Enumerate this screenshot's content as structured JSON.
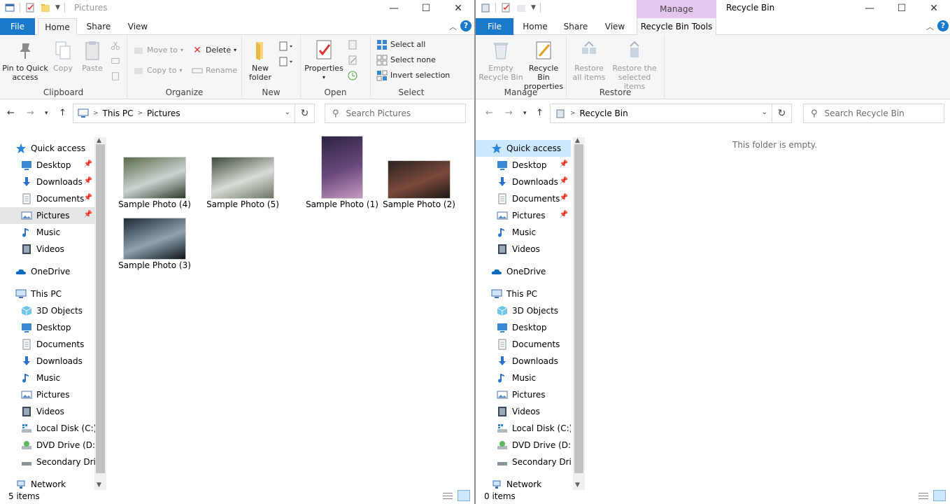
{
  "left": {
    "title": "Pictures",
    "tabs": {
      "file": "File",
      "home": "Home",
      "share": "Share",
      "view": "View"
    },
    "ribbon": {
      "clipboard": {
        "label": "Clipboard",
        "pin": "Pin to Quick\naccess",
        "copy": "Copy",
        "paste": "Paste"
      },
      "organize": {
        "label": "Organize",
        "move_to": "Move to",
        "copy_to": "Copy to",
        "delete": "Delete",
        "rename": "Rename"
      },
      "new": {
        "label": "New",
        "new_folder": "New\nfolder"
      },
      "open": {
        "label": "Open",
        "properties": "Properties"
      },
      "select": {
        "label": "Select",
        "select_all": "Select all",
        "select_none": "Select none",
        "invert": "Invert selection"
      }
    },
    "address": {
      "crumbs": [
        "This PC",
        "Pictures"
      ],
      "search_placeholder": "Search Pictures"
    },
    "nav": [
      {
        "label": "Quick access",
        "icon": "star-icon",
        "level": 0
      },
      {
        "label": "Desktop",
        "icon": "desktop-icon",
        "level": 1,
        "pinned": true
      },
      {
        "label": "Downloads",
        "icon": "download-icon",
        "level": 1,
        "pinned": true
      },
      {
        "label": "Documents",
        "icon": "document-icon",
        "level": 1,
        "pinned": true
      },
      {
        "label": "Pictures",
        "icon": "pictures-icon",
        "level": 1,
        "pinned": true,
        "highlight": true
      },
      {
        "label": "Music",
        "icon": "music-icon",
        "level": 1
      },
      {
        "label": "Videos",
        "icon": "video-icon",
        "level": 1
      },
      {
        "label": "OneDrive",
        "icon": "cloud-icon",
        "level": 0
      },
      {
        "label": "This PC",
        "icon": "computer-icon",
        "level": 0
      },
      {
        "label": "3D Objects",
        "icon": "cube-icon",
        "level": 1
      },
      {
        "label": "Desktop",
        "icon": "desktop-icon",
        "level": 1
      },
      {
        "label": "Documents",
        "icon": "document-icon",
        "level": 1
      },
      {
        "label": "Downloads",
        "icon": "download-icon",
        "level": 1
      },
      {
        "label": "Music",
        "icon": "music-icon",
        "level": 1
      },
      {
        "label": "Pictures",
        "icon": "pictures-icon",
        "level": 1
      },
      {
        "label": "Videos",
        "icon": "video-icon",
        "level": 1
      },
      {
        "label": "Local Disk (C:)",
        "icon": "disk-icon",
        "level": 1
      },
      {
        "label": "DVD Drive (D:) ES",
        "icon": "dvd-icon",
        "level": 1
      },
      {
        "label": "Secondary Drive",
        "icon": "drive-icon",
        "level": 1
      },
      {
        "label": "Network",
        "icon": "network-icon",
        "level": 0
      }
    ],
    "files": [
      {
        "name": "Sample Photo (4)",
        "colors": [
          "#5a6b4a",
          "#c9d4d0",
          "#2f3a2a"
        ]
      },
      {
        "name": "Sample Photo (5)",
        "colors": [
          "#3f4a3c",
          "#d8ddd5",
          "#6c7566"
        ]
      },
      {
        "name": "Sample Photo (1)",
        "colors": [
          "#2a2340",
          "#6b4a7e",
          "#c79bc0"
        ]
      },
      {
        "name": "Sample Photo (2)",
        "colors": [
          "#2b2422",
          "#7a4a3a",
          "#1c1816"
        ]
      },
      {
        "name": "Sample Photo (3)",
        "colors": [
          "#1f2a33",
          "#8fa3b0",
          "#0e1418"
        ]
      }
    ],
    "status": "5 items"
  },
  "right": {
    "title": "Recycle Bin",
    "context_tab": "Manage",
    "tabs": {
      "file": "File",
      "home": "Home",
      "share": "Share",
      "view": "View",
      "tools": "Recycle Bin Tools"
    },
    "ribbon": {
      "manage": {
        "label": "Manage",
        "empty": "Empty\nRecycle Bin",
        "props": "Recycle Bin\nproperties"
      },
      "restore": {
        "label": "Restore",
        "restore_all": "Restore\nall items",
        "restore_sel": "Restore the\nselected items"
      }
    },
    "address": {
      "crumbs": [
        "Recycle Bin"
      ],
      "search_placeholder": "Search Recycle Bin"
    },
    "empty_msg": "This folder is empty.",
    "status": "0 items"
  },
  "colors": {
    "file_tab": "#1979ca",
    "selected": "#cce8ff",
    "context": "#e4c6ef"
  }
}
